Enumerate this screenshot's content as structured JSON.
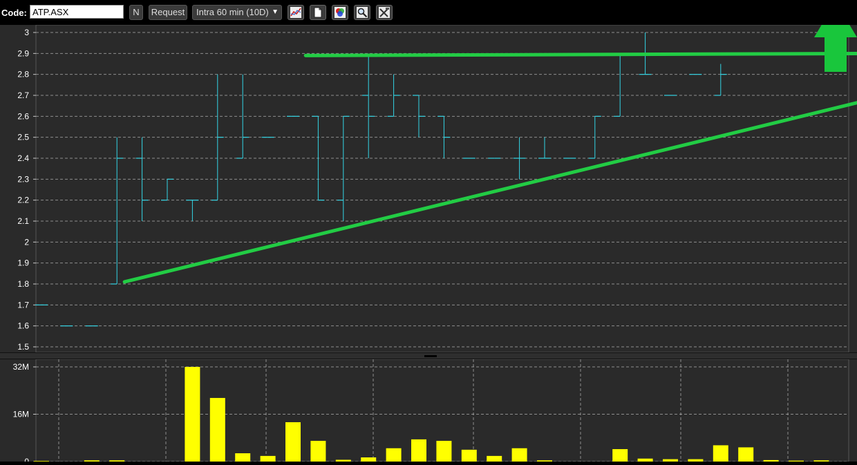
{
  "toolbar": {
    "code_label": "Code:",
    "code_value": "ATP.ASX",
    "n_label": "N",
    "request_label": "Request",
    "interval_value": "Intra 60 min (10D)",
    "icons": [
      "line-chart-icon",
      "document-icon",
      "color-palette-icon",
      "zoom-icon",
      "tools-icon"
    ]
  },
  "colors": {
    "price_bar": "#33d6e6",
    "trend_line": "#22cc44",
    "arrow": "#19c63c",
    "volume_bar": "#ffff00",
    "grid": "#bbbbbb",
    "panel_bg": "#2a2a2a"
  },
  "chart_data": [
    {
      "type": "ohlc",
      "y_ticks": [
        "3",
        "2.9",
        "2.8",
        "2.7",
        "2.6",
        "2.5",
        "2.4",
        "2.3",
        "2.2",
        "2.1",
        "2",
        "1.9",
        "1.8",
        "1.7",
        "1.6",
        "1.5"
      ],
      "ylim": [
        1.5,
        3.0
      ],
      "grid": true,
      "bars": [
        {
          "o": 1.7,
          "h": 1.7,
          "l": 1.7,
          "c": 1.7
        },
        {
          "o": 1.6,
          "h": 1.6,
          "l": 1.6,
          "c": 1.6
        },
        {
          "o": 1.6,
          "h": 1.6,
          "l": 1.6,
          "c": 1.6
        },
        {
          "o": 1.8,
          "h": 2.5,
          "l": 1.8,
          "c": 2.4
        },
        {
          "o": 2.4,
          "h": 2.5,
          "l": 2.1,
          "c": 2.2
        },
        {
          "o": 2.2,
          "h": 2.3,
          "l": 2.2,
          "c": 2.3
        },
        {
          "o": 2.2,
          "h": 2.2,
          "l": 2.1,
          "c": 2.2
        },
        {
          "o": 2.2,
          "h": 2.8,
          "l": 2.2,
          "c": 2.5
        },
        {
          "o": 2.4,
          "h": 2.8,
          "l": 2.4,
          "c": 2.5
        },
        {
          "o": 2.5,
          "h": 2.5,
          "l": 2.5,
          "c": 2.5
        },
        {
          "o": 2.6,
          "h": 2.6,
          "l": 2.6,
          "c": 2.6
        },
        {
          "o": 2.6,
          "h": 2.6,
          "l": 2.2,
          "c": 2.2
        },
        {
          "o": 2.2,
          "h": 2.6,
          "l": 2.1,
          "c": 2.6
        },
        {
          "o": 2.7,
          "h": 2.9,
          "l": 2.4,
          "c": 2.6
        },
        {
          "o": 2.6,
          "h": 2.8,
          "l": 2.6,
          "c": 2.7
        },
        {
          "o": 2.7,
          "h": 2.7,
          "l": 2.5,
          "c": 2.6
        },
        {
          "o": 2.6,
          "h": 2.6,
          "l": 2.4,
          "c": 2.5
        },
        {
          "o": 2.4,
          "h": 2.4,
          "l": 2.4,
          "c": 2.4
        },
        {
          "o": 2.4,
          "h": 2.4,
          "l": 2.4,
          "c": 2.4
        },
        {
          "o": 2.4,
          "h": 2.5,
          "l": 2.3,
          "c": 2.4
        },
        {
          "o": 2.4,
          "h": 2.5,
          "l": 2.4,
          "c": 2.4
        },
        {
          "o": 2.4,
          "h": 2.4,
          "l": 2.4,
          "c": 2.4
        },
        {
          "o": 2.4,
          "h": 2.6,
          "l": 2.4,
          "c": 2.6
        },
        {
          "o": 2.6,
          "h": 2.9,
          "l": 2.6,
          "c": 2.9
        },
        {
          "o": 2.8,
          "h": 3.0,
          "l": 2.8,
          "c": 2.8
        },
        {
          "o": 2.7,
          "h": 2.7,
          "l": 2.7,
          "c": 2.7
        },
        {
          "o": 2.8,
          "h": 2.8,
          "l": 2.8,
          "c": 2.8
        },
        {
          "o": 2.7,
          "h": 2.85,
          "l": 2.7,
          "c": 2.8
        }
      ],
      "trendlines": [
        {
          "from": {
            "bar": 3.3,
            "price": 1.81
          },
          "to": {
            "bar": 32.6,
            "price": 2.67
          }
        },
        {
          "from": {
            "bar": 10.5,
            "price": 2.89
          },
          "to": {
            "bar": 33.5,
            "price": 2.9
          }
        }
      ]
    },
    {
      "type": "bar",
      "y_ticks": [
        "32M",
        "16M",
        "0"
      ],
      "ylim": [
        0,
        32
      ],
      "unit": "M",
      "grid": true,
      "values": [
        0.2,
        0,
        0.4,
        0.4,
        0,
        0,
        32.0,
        21.5,
        2.8,
        1.9,
        13.3,
        7.0,
        0.6,
        1.4,
        4.5,
        7.5,
        7.0,
        4.0,
        1.9,
        4.5,
        0.4,
        0,
        0,
        4.2,
        1.0,
        0.8,
        0.8,
        5.5,
        4.8,
        0.5,
        0.3,
        0.4
      ]
    }
  ]
}
